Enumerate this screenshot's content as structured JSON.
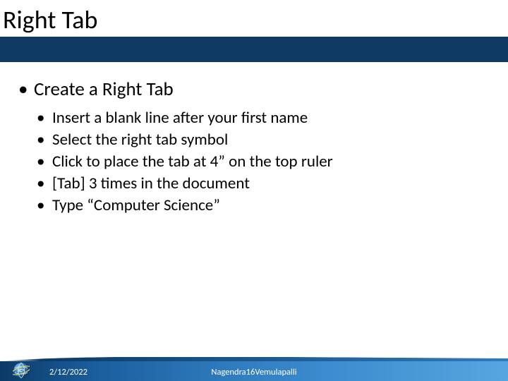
{
  "title": "Right Tab",
  "body": {
    "heading": "Create a Right Tab",
    "items": [
      "Insert a blank line after your first name",
      "Select the right tab symbol",
      "Click to place the tab at 4” on the top ruler",
      "[Tab] 3 times in the document",
      "Type “Computer Science”"
    ]
  },
  "footer": {
    "date": "2/12/2022",
    "author": "Nagendra Vemulapalli",
    "page": "16"
  }
}
